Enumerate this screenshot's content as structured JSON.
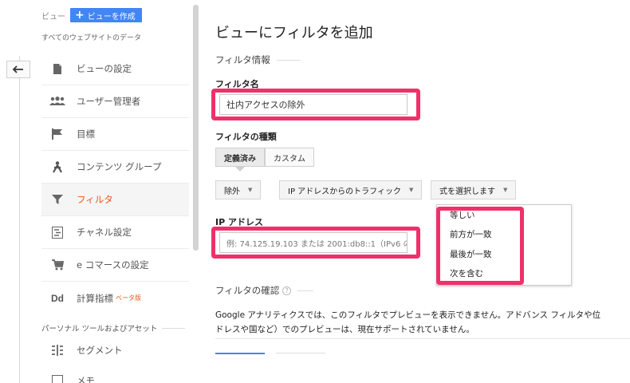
{
  "sidebar": {
    "view_label": "ビュー",
    "create_view_label": "ビューを作成",
    "subtitle": "すべてのウェブサイトのデータ",
    "items": [
      {
        "label": "ビューの設定",
        "icon": "document-icon"
      },
      {
        "label": "ユーザー管理者",
        "icon": "users-icon"
      },
      {
        "label": "目標",
        "icon": "flag-icon"
      },
      {
        "label": "コンテンツ グループ",
        "icon": "person-walk-icon"
      },
      {
        "label": "フィルタ",
        "icon": "funnel-icon",
        "active": true
      },
      {
        "label": "チャネル設定",
        "icon": "channel-icon"
      },
      {
        "label": "e コマースの設定",
        "icon": "cart-icon"
      },
      {
        "label": "計算指標",
        "icon": "dd-icon",
        "badge": "ベータ版"
      }
    ],
    "section_title": "パーソナル ツールおよびアセット",
    "section_items": [
      {
        "label": "セグメント",
        "icon": "segment-icon"
      },
      {
        "label": "メモ",
        "icon": "memo-icon"
      }
    ]
  },
  "main": {
    "title": "ビューにフィルタを追加",
    "filter_info_heading": "フィルタ情報",
    "filter_name_label": "フィルタ名",
    "filter_name_value": "社内アクセスの除外",
    "filter_type_label": "フィルタの種類",
    "tabs": [
      "定義済み",
      "カスタム"
    ],
    "dropdowns": {
      "exclude": "除外",
      "source": "IP アドレスからのトラフィック",
      "expression": "式を選択します"
    },
    "expression_options": [
      "等しい",
      "前方が一致",
      "最後が一致",
      "次を含む"
    ],
    "ip_label": "IP アドレス",
    "ip_placeholder": "例: 74.125.19.103 または 2001:db8::1（IPv6 の",
    "verify_heading": "フィルタの確認",
    "description": "Google アナリティクスでは、このフィルタでプレビューを表示できません。アドバンス フィルタや位置（ドレスや国など）でのプレビューは、現在サポートされていません。",
    "description_line1": "Google アナリティクスでは、このフィルタでプレビューを表示できません。アドバンス フィルタや位",
    "description_line2": "ドレスや国など）でのプレビューは、現在サポートされていません。"
  },
  "colors": {
    "accent_blue": "#4285f4",
    "active_orange": "#e8561e",
    "highlight_pink": "#f0306a"
  }
}
